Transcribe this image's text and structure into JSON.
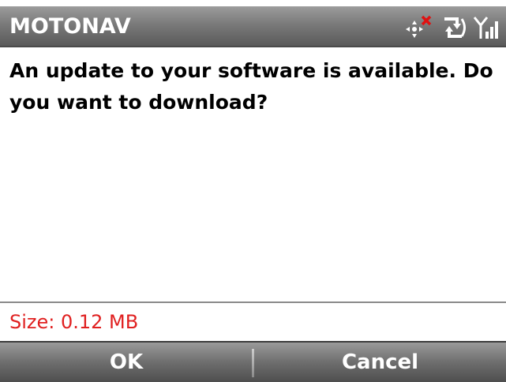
{
  "app": {
    "title": "MOTONAV"
  },
  "status_icons": [
    {
      "name": "gps-no-signal-icon"
    },
    {
      "name": "sync-connection-icon"
    },
    {
      "name": "signal-strength-icon"
    }
  ],
  "dialog": {
    "message": "An update to your software is available. Do you want to download?",
    "size_label": "Size: 0.12 MB"
  },
  "softkeys": {
    "left_label": "OK",
    "right_label": "Cancel"
  },
  "colors": {
    "titlebar": "#7a7a7a",
    "size_text": "#e02020",
    "softkey_text": "#ffffff"
  }
}
